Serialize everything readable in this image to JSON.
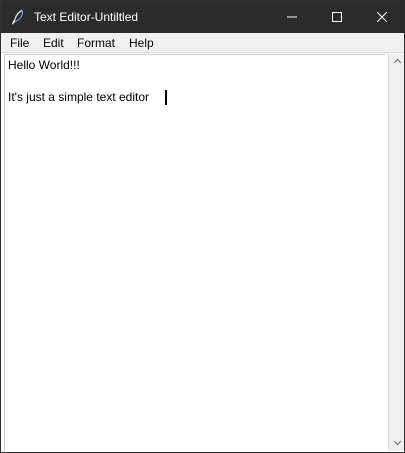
{
  "window": {
    "title": "Text Editor-Untiltled"
  },
  "menu": {
    "items": [
      "File",
      "Edit",
      "Format",
      "Help"
    ]
  },
  "editor": {
    "lines": [
      "Hello World!!!",
      "",
      "It's just a simple text editor"
    ]
  },
  "icons": {
    "app": "feather-icon",
    "minimize": "minimize-icon",
    "maximize": "maximize-icon",
    "close": "close-icon",
    "scroll_up": "scroll-up-icon",
    "scroll_down": "scroll-down-icon"
  },
  "colors": {
    "titlebar": "#2b2b2b",
    "menubar": "#f0f0f0",
    "editor_bg": "#ffffff",
    "text": "#000000"
  }
}
